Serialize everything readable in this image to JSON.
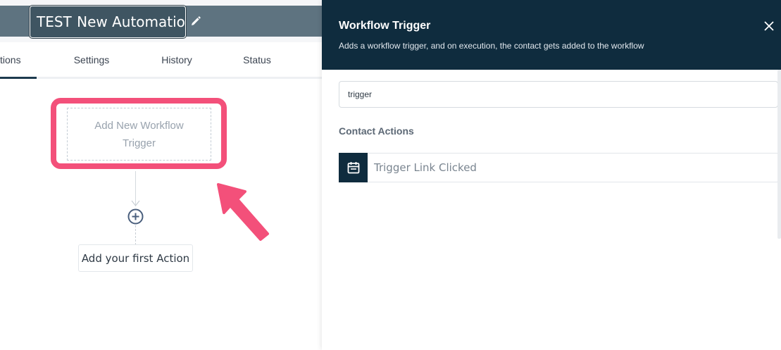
{
  "workflow": {
    "name_part1": "TEST ",
    "name_part2": "New Automation"
  },
  "tabs": [
    {
      "label": "tions",
      "active": true
    },
    {
      "label": "Settings",
      "active": false
    },
    {
      "label": "History",
      "active": false
    },
    {
      "label": "Status",
      "active": false
    }
  ],
  "canvas": {
    "trigger_placeholder": "Add New Workflow Trigger",
    "first_action_label": "Add your first Action"
  },
  "drawer": {
    "title": "Workflow Trigger",
    "subtitle": "Adds a workflow trigger, and on execution, the contact gets added to the workflow",
    "search": {
      "value": "trigger",
      "placeholder": ""
    },
    "section_title": "Contact Actions",
    "items": [
      {
        "label": "Trigger Link Clicked",
        "icon": "calendar-icon"
      }
    ]
  },
  "colors": {
    "header_dark": "#0f2c3e",
    "topbar": "#5e7380",
    "highlight": "#f3507a"
  }
}
